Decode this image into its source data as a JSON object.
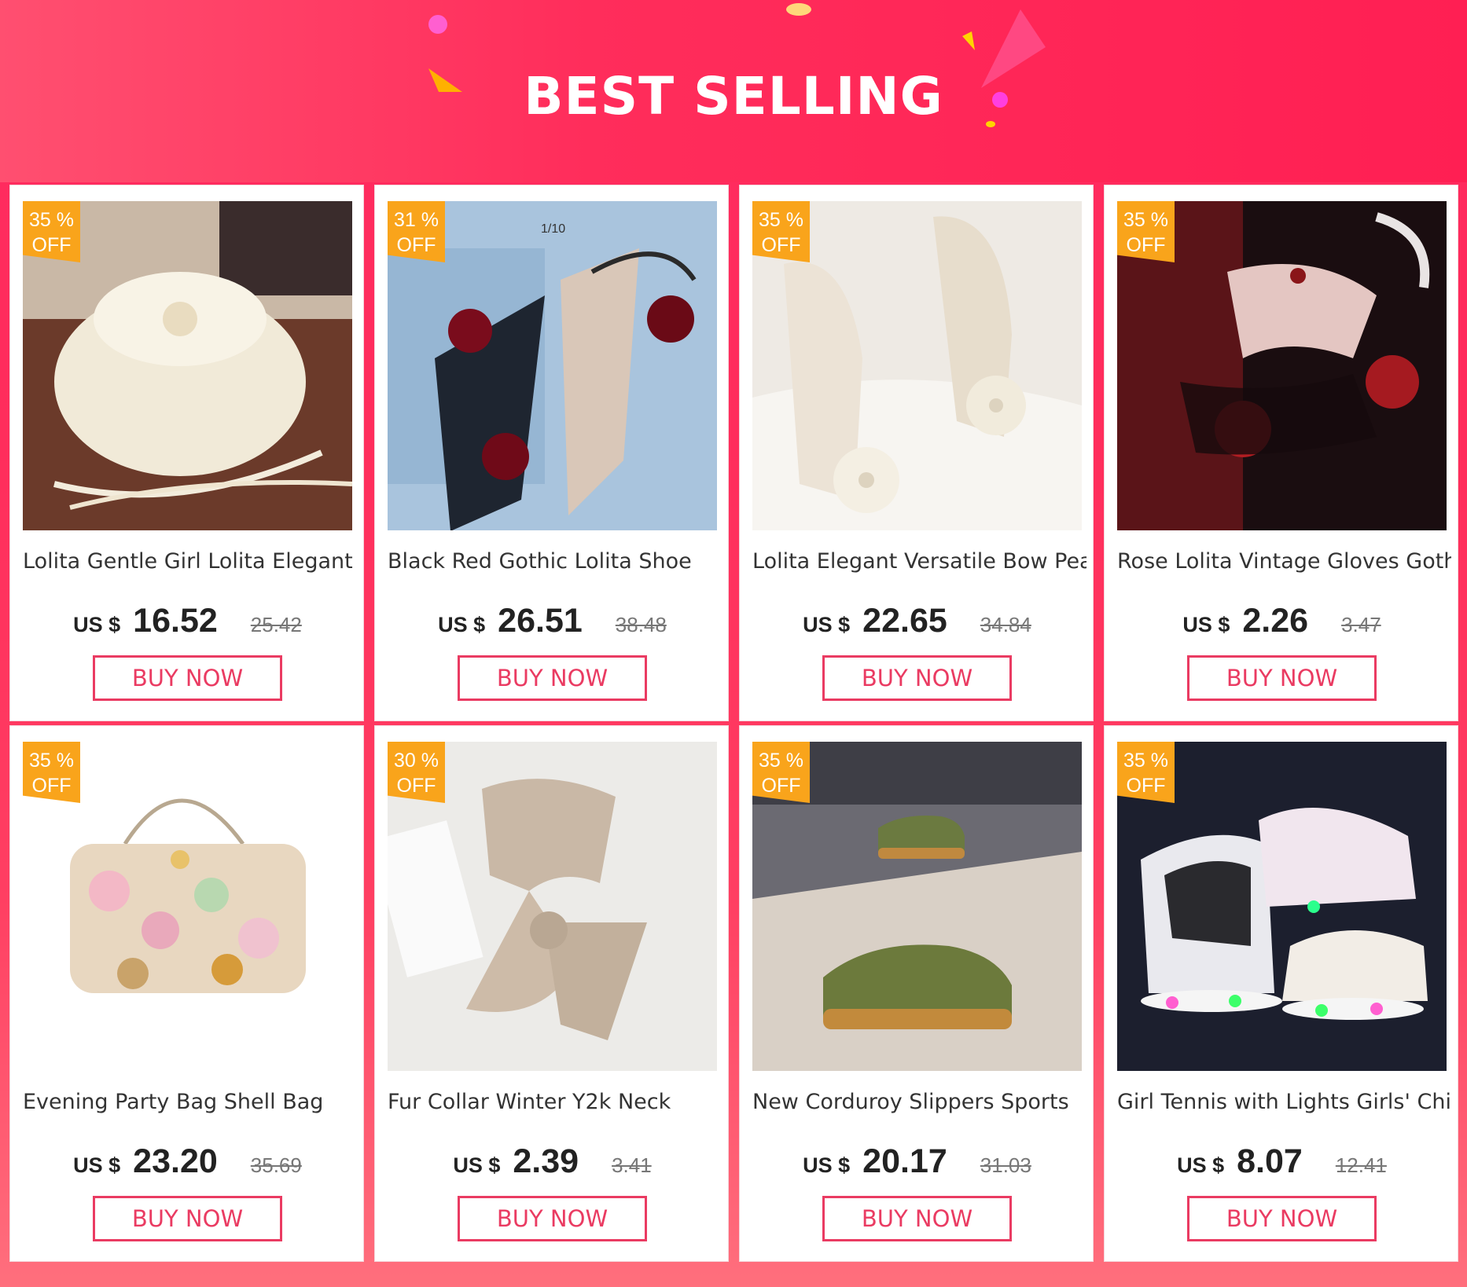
{
  "header": {
    "title": "BEST SELLING"
  },
  "colors": {
    "accent": "#ea3b62",
    "badge": "#f9a41b",
    "background": "#ff2d5c"
  },
  "products": [
    {
      "discount_line1": "35 %",
      "discount_line2": "OFF",
      "title": "Lolita Gentle Girl Lolita Elegant",
      "currency": "US $",
      "price": "16.52",
      "old_price": "25.42",
      "button": "BUY NOW",
      "image": "lace-bow-bag-photo"
    },
    {
      "discount_line1": "31 %",
      "discount_line2": "OFF",
      "title": "Black Red Gothic Lolita Shoe",
      "currency": "US $",
      "price": "26.51",
      "old_price": "38.48",
      "button": "BUY NOW",
      "image": "gothic-heels-photo",
      "image_text": "1/10"
    },
    {
      "discount_line1": "35 %",
      "discount_line2": "OFF",
      "title": "Lolita Elegant Versatile Bow Pearl",
      "currency": "US $",
      "price": "22.65",
      "old_price": "34.84",
      "button": "BUY NOW",
      "image": "pearl-sandals-photo"
    },
    {
      "discount_line1": "35 %",
      "discount_line2": "OFF",
      "title": "Rose Lolita Vintage Gloves Gothic",
      "currency": "US $",
      "price": "2.26",
      "old_price": "3.47",
      "button": "BUY NOW",
      "image": "rose-gloves-photo"
    },
    {
      "discount_line1": "35 %",
      "discount_line2": "OFF",
      "title": "Evening Party Bag Shell Bag",
      "currency": "US $",
      "price": "23.20",
      "old_price": "35.69",
      "button": "BUY NOW",
      "image": "flower-clutch-photo"
    },
    {
      "discount_line1": "30 %",
      "discount_line2": "OFF",
      "title": "Fur Collar Winter Y2k Neck",
      "currency": "US $",
      "price": "2.39",
      "old_price": "3.41",
      "button": "BUY NOW",
      "image": "fur-collar-photo"
    },
    {
      "discount_line1": "35 %",
      "discount_line2": "OFF",
      "title": "New Corduroy Slippers Sports",
      "currency": "US $",
      "price": "20.17",
      "old_price": "31.03",
      "button": "BUY NOW",
      "image": "green-sneakers-photo"
    },
    {
      "discount_line1": "35 %",
      "discount_line2": "OFF",
      "title": "Girl Tennis with Lights Girls' Child",
      "currency": "US $",
      "price": "8.07",
      "old_price": "12.41",
      "button": "BUY NOW",
      "image": "light-up-sneakers-photo"
    }
  ]
}
